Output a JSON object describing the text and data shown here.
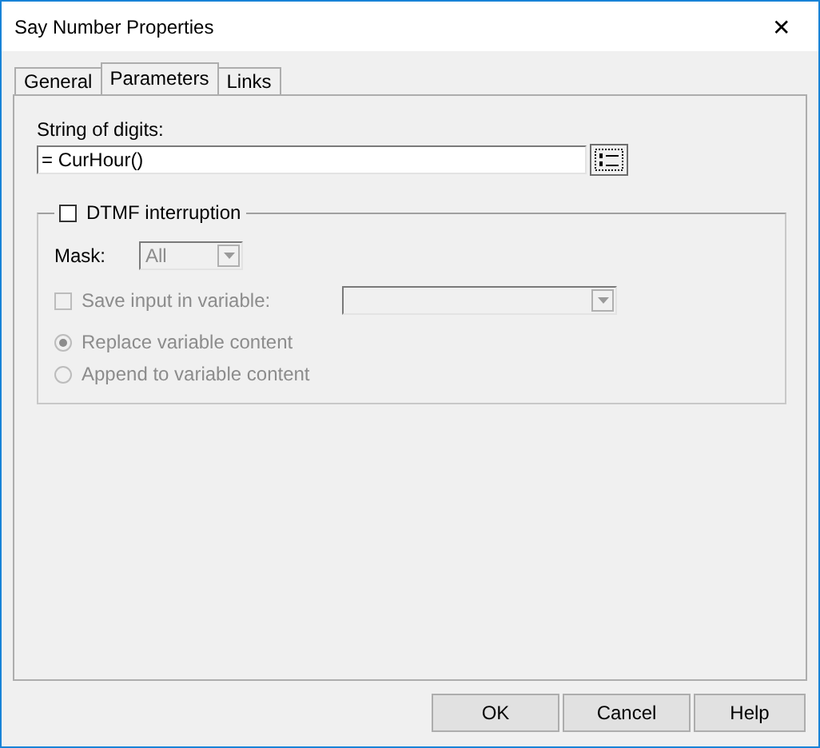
{
  "window": {
    "title": "Say Number Properties",
    "close": "✕"
  },
  "tabs": [
    {
      "label": "General",
      "selected": false
    },
    {
      "label": "Parameters",
      "selected": true
    },
    {
      "label": "Links",
      "selected": false
    }
  ],
  "digits": {
    "label": "String of digits:",
    "value": "= CurHour()"
  },
  "dtmf": {
    "label": "DTMF interruption",
    "checked": false,
    "mask": {
      "label": "Mask:",
      "value": "All",
      "disabled": true
    },
    "save": {
      "label": "Save input in variable:",
      "checked": false,
      "disabled": true
    },
    "options": [
      {
        "label": "Replace variable content",
        "selected": true,
        "disabled": true
      },
      {
        "label": "Append to variable content",
        "selected": false,
        "disabled": true
      }
    ]
  },
  "buttons": [
    "OK",
    "Cancel",
    "Help"
  ]
}
